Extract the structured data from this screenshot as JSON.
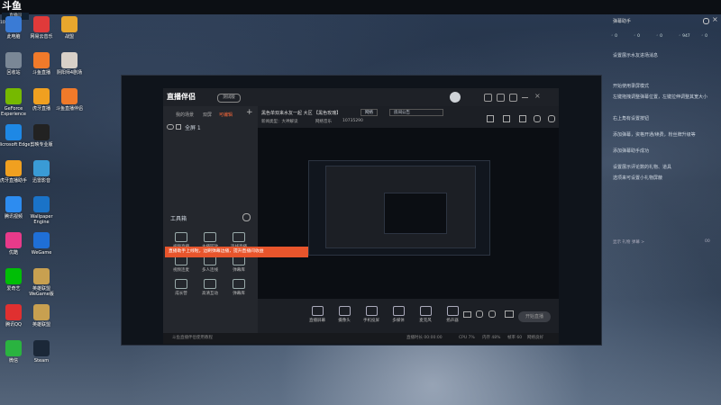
{
  "douyu": {
    "logo": "斗鱼",
    "sub_label": "直播间",
    "room_number": "10735290"
  },
  "desktop_icons": [
    {
      "label": "此电脑",
      "color": "#3a7bd5"
    },
    {
      "label": "网易云音乐",
      "color": "#e03a3a"
    },
    {
      "label": "战盟",
      "color": "#e8a72d"
    },
    {
      "label": "回收站",
      "color": "#7a8796"
    },
    {
      "label": "斗鱼直播",
      "color": "#f07a2a"
    },
    {
      "label": "阴阳师4剧场",
      "color": "#d8d0c8"
    },
    {
      "label": "GeForce Experience",
      "color": "#76b900"
    },
    {
      "label": "虎牙直播",
      "color": "#f0a020"
    },
    {
      "label": "斗鱼直播伴侣",
      "color": "#f07a2a"
    },
    {
      "label": "Microsoft Edge",
      "color": "#1e88e5"
    },
    {
      "label": "剪映专业版",
      "color": "#222222"
    },
    {
      "label": "",
      "color": "#00000000"
    },
    {
      "label": "虎牙直播助手",
      "color": "#f0a020"
    },
    {
      "label": "迅雷影音",
      "color": "#3a9bd5"
    },
    {
      "label": "",
      "color": "#00000000"
    },
    {
      "label": "腾讯视频",
      "color": "#2d8cf0"
    },
    {
      "label": "Wallpaper Engine",
      "color": "#1a73c8"
    },
    {
      "label": "",
      "color": "#00000000"
    },
    {
      "label": "优酷",
      "color": "#e83a8a"
    },
    {
      "label": "WeGame",
      "color": "#1f6fd6"
    },
    {
      "label": "",
      "color": "#00000000"
    },
    {
      "label": "爱奇艺",
      "color": "#00be06"
    },
    {
      "label": "英雄联盟 WeGame版",
      "color": "#c8a050"
    },
    {
      "label": "",
      "color": "#00000000"
    },
    {
      "label": "腾讯QQ",
      "color": "#e03030"
    },
    {
      "label": "英雄联盟",
      "color": "#c8a050"
    },
    {
      "label": "",
      "color": "#00000000"
    },
    {
      "label": "微信",
      "color": "#2ab340"
    },
    {
      "label": "Steam",
      "color": "#1b2838"
    }
  ],
  "right_panel": {
    "title": "弹幕助手",
    "stats": [
      "0",
      "0",
      "0",
      "947",
      "0"
    ],
    "notice": "设置展示水友进场消息",
    "messages": [
      "开始使用录屏模式",
      "左键拖拽调整弹幕位置，左键拉伸调整其宽大小",
      "右上角有设置按钮",
      "添加弹幕，资格开通/续费，粉丝牌升级等",
      "添加弹幕助手成功",
      "设置展示评论数的礼物、道具",
      "选项来可设置小礼物屏蔽"
    ],
    "footer_left": "显示 礼物 弹幕 >",
    "footer_right": "00"
  },
  "app": {
    "logo": "直播伴侣",
    "version_badge": "测试版",
    "tabs": [
      "我的场景",
      "双屏",
      "可编辑"
    ],
    "scene_item": "全屏 1",
    "room_title": "黑色单双来水友一起 大区 【黑色玫瑰】",
    "room_tag": "网络",
    "room_notice": "房间公告",
    "category_label": "新闻类型：大神解读",
    "network_label": "网络音乐",
    "room_id": "10735290",
    "toolbox_label": "工具箱",
    "tools": [
      {
        "label": "视频直播"
      },
      {
        "label": "主播回放"
      },
      {
        "label": "连线直播"
      },
      {
        "label": "视频连麦"
      },
      {
        "label": "多人连线"
      },
      {
        "label": "弹幕库"
      },
      {
        "label": "成长营"
      },
      {
        "label": "高清互动"
      },
      {
        "label": "弹幕库"
      }
    ],
    "banner_text": "直播助手上线啦，边刷弹幕边播，提升直播间收益",
    "status_left": "斗鱼直播伴侣使用教程",
    "controls": [
      {
        "label": "直播屏幕"
      },
      {
        "label": "摄像头"
      },
      {
        "label": "手机投屏"
      },
      {
        "label": "多媒体"
      },
      {
        "label": "麦克风"
      },
      {
        "label": "扬声器"
      }
    ],
    "start_button": "开始直播",
    "status_items": [
      "直播时长 00:00:00",
      "CPU 7%",
      "内存 48%",
      "帧率 60",
      "网络良好"
    ]
  }
}
